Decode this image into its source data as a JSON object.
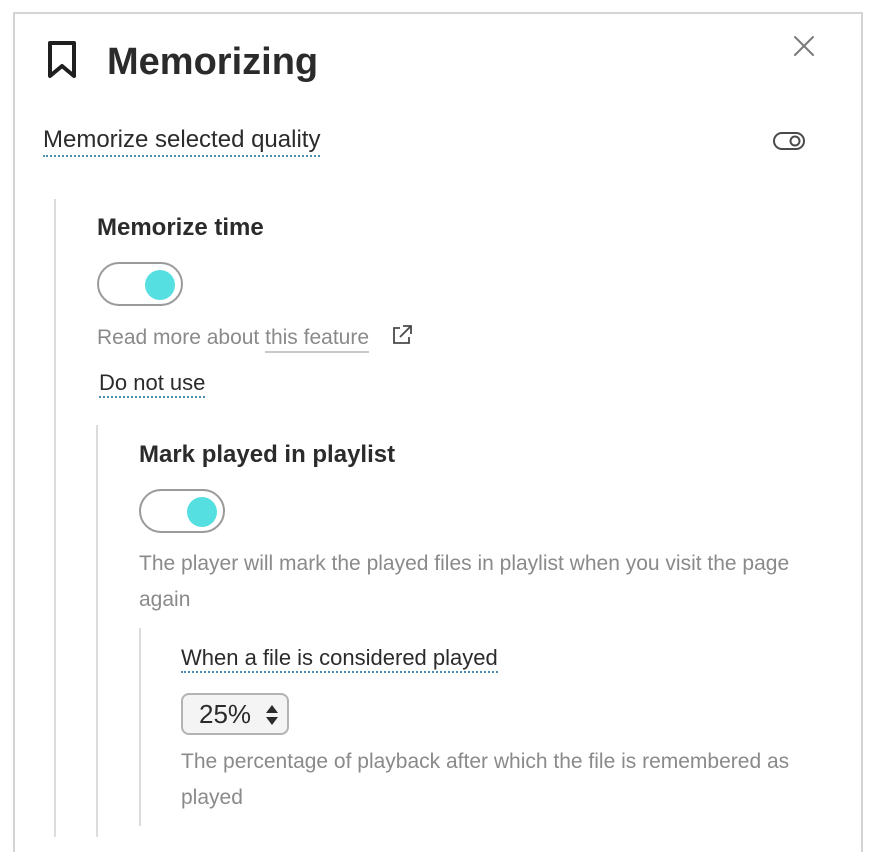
{
  "dialog": {
    "title": "Memorizing",
    "icons": {
      "title": "bookmark-icon",
      "close": "close-icon",
      "external": "external-link-icon"
    }
  },
  "settings": {
    "memorize_quality": {
      "label": "Memorize selected quality",
      "toggle_on": false
    },
    "memorize_time": {
      "label": "Memorize time",
      "toggle_on": true,
      "hint_prefix": "Read more about",
      "hint_link": "this feature",
      "option_link": "Do not use"
    },
    "mark_played": {
      "label": "Mark played in playlist",
      "toggle_on": true,
      "description": "The player will mark the played files in playlist when you visit the page again"
    },
    "played_threshold": {
      "label": "When a file is considered played",
      "value": "25%",
      "description": "The percentage of playback after which the file is remembered as played"
    }
  },
  "colors": {
    "toggle_knob": "#56dfe0",
    "link_underline": "#4a8db3",
    "hint_text": "#8a8a8a"
  }
}
